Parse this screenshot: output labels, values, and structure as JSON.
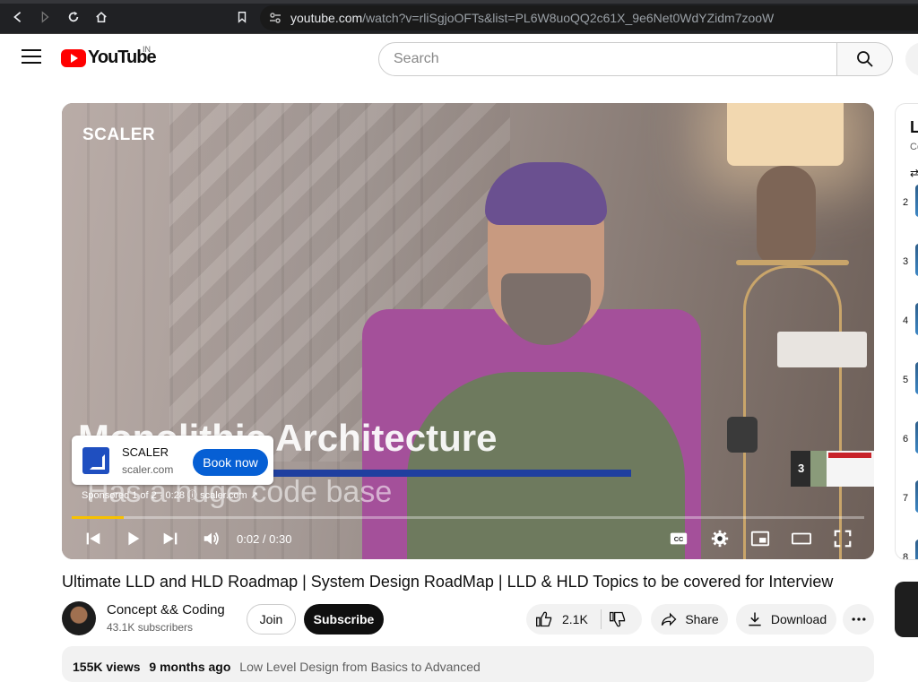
{
  "browser": {
    "url_host": "youtube.com",
    "url_path": "/watch?v=rliSgjoOFTs&list=PL6W8uoQQ2c61X_9e6Net0WdYZidm7zooW"
  },
  "header": {
    "logo_text": "YouTube",
    "country_code": "IN",
    "search_placeholder": "Search"
  },
  "player": {
    "brand_watermark": "SCALER",
    "overlay_title": "Monolithic Architecture",
    "overlay_subtitle": "Has a huge code base",
    "ad": {
      "name": "SCALER",
      "domain": "scaler.com",
      "cta": "Book now",
      "sponsored_text": "Sponsored 1 of 2 · 0:28",
      "link_text": "scaler.com"
    },
    "next_thumb_index": "3",
    "time_display": "0:02 / 0:30",
    "progress": 0.066
  },
  "video": {
    "title": "Ultimate LLD and HLD Roadmap | System Design RoadMap | LLD & HLD Topics to be covered for Interview",
    "channel_name": "Concept && Coding",
    "subscribers": "43.1K subscribers",
    "join_label": "Join",
    "subscribe_label": "Subscribe",
    "likes": "2.1K",
    "share_label": "Share",
    "download_label": "Download",
    "views": "155K views",
    "age": "9 months ago",
    "playlist": "Low Level Design from Basics to Advanced"
  },
  "playlist_panel": {
    "title_initial": "L",
    "sub_initial": "Co",
    "items": [
      "2",
      "3",
      "4",
      "5",
      "6",
      "7",
      "8"
    ]
  }
}
